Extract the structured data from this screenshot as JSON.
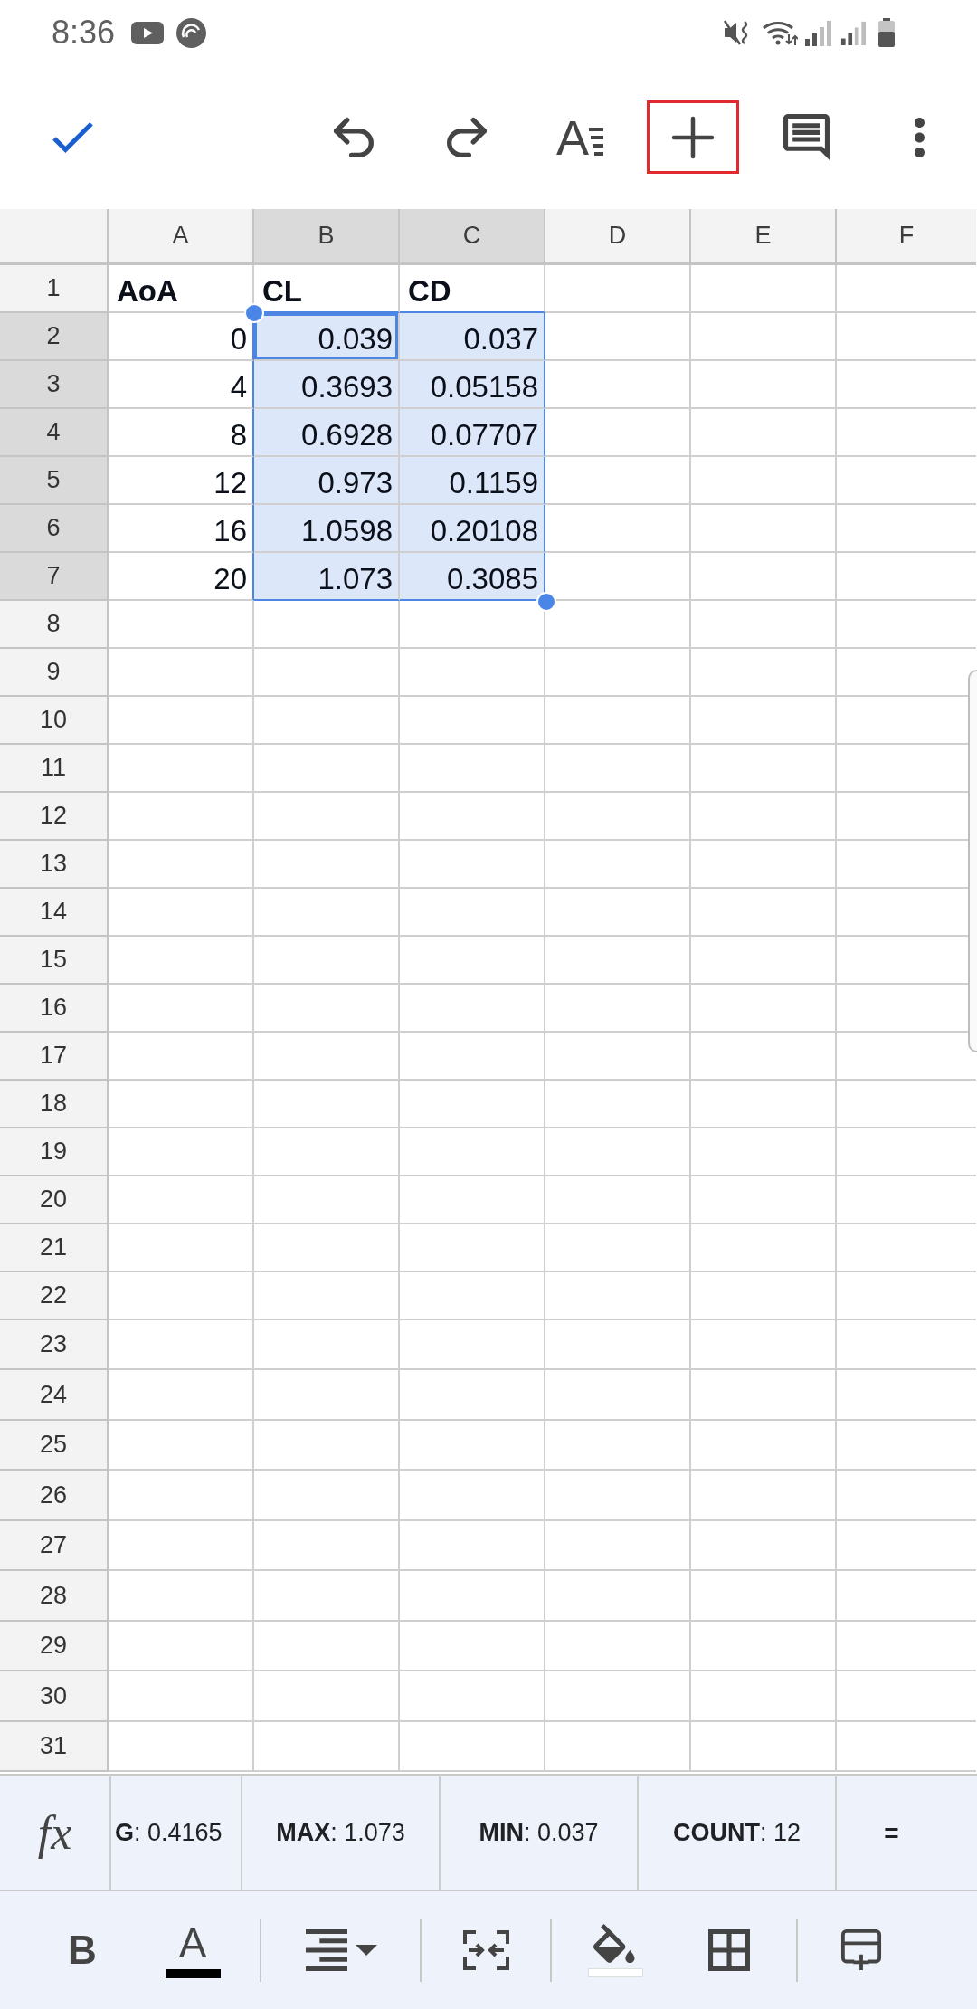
{
  "status_bar": {
    "time": "8:36"
  },
  "toolbar": [
    {
      "kind": "done",
      "highlighted": false
    },
    {
      "kind": "undo",
      "highlighted": false
    },
    {
      "kind": "redo",
      "highlighted": false
    },
    {
      "kind": "text_format",
      "glyph": "A",
      "highlighted": false
    },
    {
      "kind": "insert",
      "highlighted": true
    },
    {
      "kind": "comment",
      "highlighted": false
    },
    {
      "kind": "more",
      "highlighted": false
    }
  ],
  "sheet": {
    "columns": [
      {
        "label": "A",
        "selected": false
      },
      {
        "label": "B",
        "selected": true
      },
      {
        "label": "C",
        "selected": true
      },
      {
        "label": "D",
        "selected": false
      },
      {
        "label": "E",
        "selected": false
      },
      {
        "label": "F",
        "selected": false
      }
    ],
    "rows": [
      {
        "label": "1",
        "selected": false,
        "cells": [
          {
            "kind": "header",
            "text": "AoA",
            "selected": false,
            "active": false
          },
          {
            "kind": "header",
            "text": "CL",
            "selected": false,
            "active": false
          },
          {
            "kind": "header",
            "text": "CD",
            "selected": false,
            "active": false
          }
        ]
      },
      {
        "label": "2",
        "selected": true,
        "cells": [
          {
            "kind": "number",
            "text": "0",
            "selected": false,
            "active": false
          },
          {
            "kind": "number",
            "text": "0.039",
            "selected": true,
            "active": true
          },
          {
            "kind": "number",
            "text": "0.037",
            "selected": true,
            "active": false
          }
        ]
      },
      {
        "label": "3",
        "selected": true,
        "cells": [
          {
            "kind": "number",
            "text": "4",
            "selected": false,
            "active": false
          },
          {
            "kind": "number",
            "text": "0.3693",
            "selected": true,
            "active": false
          },
          {
            "kind": "number",
            "text": "0.05158",
            "selected": true,
            "active": false
          }
        ]
      },
      {
        "label": "4",
        "selected": true,
        "cells": [
          {
            "kind": "number",
            "text": "8",
            "selected": false,
            "active": false
          },
          {
            "kind": "number",
            "text": "0.6928",
            "selected": true,
            "active": false
          },
          {
            "kind": "number",
            "text": "0.07707",
            "selected": true,
            "active": false
          }
        ]
      },
      {
        "label": "5",
        "selected": true,
        "cells": [
          {
            "kind": "number",
            "text": "12",
            "selected": false,
            "active": false
          },
          {
            "kind": "number",
            "text": "0.973",
            "selected": true,
            "active": false
          },
          {
            "kind": "number",
            "text": "0.1159",
            "selected": true,
            "active": false
          }
        ]
      },
      {
        "label": "6",
        "selected": true,
        "cells": [
          {
            "kind": "number",
            "text": "16",
            "selected": false,
            "active": false
          },
          {
            "kind": "number",
            "text": "1.0598",
            "selected": true,
            "active": false
          },
          {
            "kind": "number",
            "text": "0.20108",
            "selected": true,
            "active": false
          }
        ]
      },
      {
        "label": "7",
        "selected": true,
        "cells": [
          {
            "kind": "number",
            "text": "20",
            "selected": false,
            "active": false
          },
          {
            "kind": "number",
            "text": "1.073",
            "selected": true,
            "active": false
          },
          {
            "kind": "number",
            "text": "0.3085",
            "selected": true,
            "active": false
          }
        ]
      },
      {
        "label": "8",
        "selected": false
      },
      {
        "label": "9",
        "selected": false
      },
      {
        "label": "10",
        "selected": false
      },
      {
        "label": "11",
        "selected": false
      },
      {
        "label": "12",
        "selected": false
      },
      {
        "label": "13",
        "selected": false
      },
      {
        "label": "14",
        "selected": false
      },
      {
        "label": "15",
        "selected": false
      },
      {
        "label": "16",
        "selected": false
      },
      {
        "label": "17",
        "selected": false
      },
      {
        "label": "18",
        "selected": false
      },
      {
        "label": "19",
        "selected": false
      },
      {
        "label": "20",
        "selected": false
      },
      {
        "label": "21",
        "selected": false
      },
      {
        "label": "22",
        "selected": false
      },
      {
        "label": "23",
        "selected": false
      },
      {
        "label": "24",
        "selected": false
      },
      {
        "label": "25",
        "selected": false
      },
      {
        "label": "26",
        "selected": false
      },
      {
        "label": "27",
        "selected": false
      },
      {
        "label": "28",
        "selected": false
      },
      {
        "label": "29",
        "selected": false
      },
      {
        "label": "30",
        "selected": false
      },
      {
        "label": "31",
        "selected": false
      }
    ]
  },
  "summary_bar": {
    "function_glyph": "fx",
    "stats": [
      {
        "kind": "stat",
        "text": "**G**: 0.4165"
      },
      {
        "kind": "stat",
        "text": "**MAX**: 1.073"
      },
      {
        "kind": "stat",
        "text": "**MIN**: 0.037"
      },
      {
        "kind": "stat",
        "text": "**COUNT**: 12"
      },
      {
        "kind": "symbol",
        "text": "="
      }
    ]
  },
  "format_toolbar": [
    {
      "kind": "bold",
      "glyph": "B"
    },
    {
      "kind": "text_color",
      "glyph": "A",
      "color": "#000000"
    },
    {
      "kind": "align"
    },
    {
      "kind": "merge"
    },
    {
      "kind": "fill_color",
      "color": "#ffffff"
    },
    {
      "kind": "borders"
    },
    {
      "kind": "insert_row"
    }
  ]
}
